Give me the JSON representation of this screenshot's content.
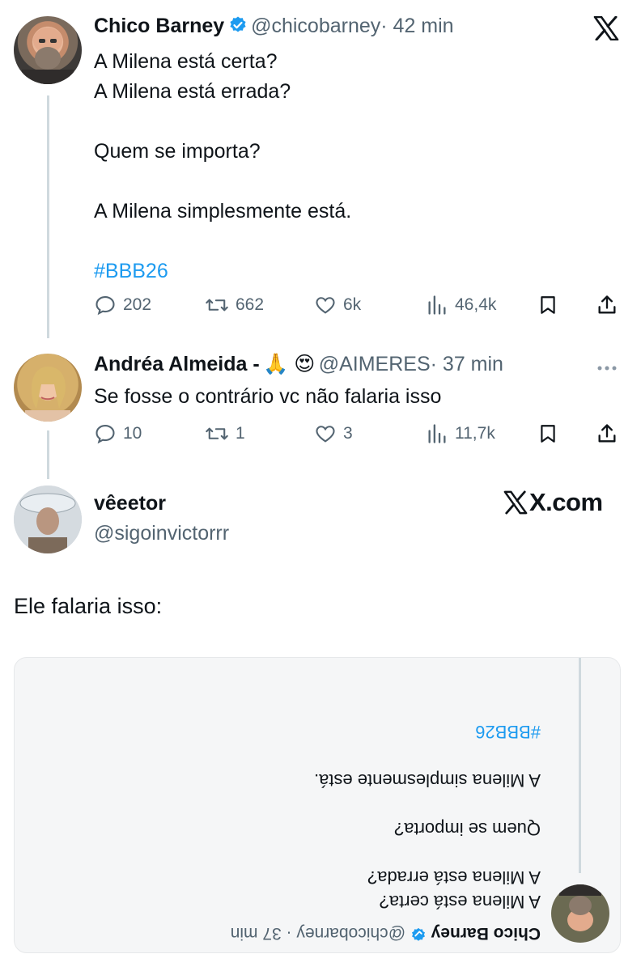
{
  "tweet1": {
    "author_name": "Chico Barney",
    "handle": "@chicobarney",
    "time": "· 42 min",
    "lines": [
      "A Milena está certa?",
      "A Milena está errada?",
      "",
      "Quem se importa?",
      "",
      "A Milena simplesmente está.",
      ""
    ],
    "hashtag": "#BBB26",
    "stats": {
      "replies": "202",
      "reposts": "662",
      "likes": "6k",
      "views": "46,4k"
    }
  },
  "reply": {
    "author_name": "Andréa Almeida -",
    "emoji": "🙏 😍",
    "handle": "@AIMERES",
    "time": "· 37 min",
    "text": "Se fosse o contrário vc não falaria isso",
    "stats": {
      "replies": "10",
      "reposts": "1",
      "likes": "3",
      "views": "11,7k"
    }
  },
  "header2": {
    "author_name": "vêeetor",
    "handle": "@sigoinvictorrr",
    "brand": "X.com"
  },
  "main_text": "Ele falaria isso:",
  "quoted": {
    "author_name": "Chico Barney",
    "handle": "@chicobarney",
    "time": "· 37 min",
    "line1": "A Milena está certa?",
    "line2": "A Milena está errada?",
    "line3": "Quem se importa?",
    "line4": "A Milena simplesmente está.",
    "hashtag": "#BBB26"
  },
  "colors": {
    "accent": "#1d9bf0",
    "muted": "#536471",
    "text": "#0f1419"
  }
}
